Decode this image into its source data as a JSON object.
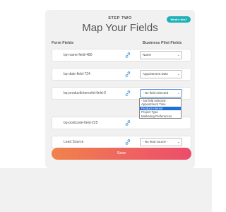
{
  "header": {
    "step": "STEP TWO",
    "title": "Map Your Fields",
    "help_button": "What's this?"
  },
  "columns": {
    "left": "Form Fields",
    "right": "Business Pilot Fields"
  },
  "rows": [
    {
      "form_field": "bp-name-field-480",
      "selected": "Name"
    },
    {
      "form_field": "bp-date-field-724",
      "selected": "Appointment Date"
    },
    {
      "form_field": "bp-productInterestId-field-6",
      "selected": "- No field selected -"
    },
    {
      "form_field": "bp-postcode-field-225",
      "selected": ""
    },
    {
      "form_field": "Lead Source",
      "selected": "- No lead source -"
    }
  ],
  "dropdown": {
    "open_row": 2,
    "options": [
      "- No field selected -",
      "Appointment Time",
      "Product Interest",
      "Project Type",
      "Marketing Preferences"
    ],
    "highlighted": "Product Interest"
  },
  "save_label": "Save",
  "colors": {
    "card_bg": "#f1f1f1",
    "help_button": "#1fb1b8",
    "save_gradient_start": "#f0834a",
    "save_gradient_end": "#ec4d6a",
    "dropdown_highlight": "#1e6fd9"
  },
  "icons": {
    "link": "link-icon",
    "select_arrow": "chevron-down-icon"
  }
}
